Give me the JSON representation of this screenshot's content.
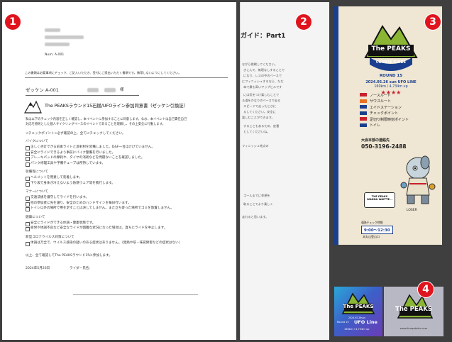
{
  "badges": [
    "1",
    "2",
    "3",
    "4"
  ],
  "doc1": {
    "num": "Num: A-001",
    "note": "この書類は必要事項にチェック、ご記入いただき、受付にご提出いただく書類です。携帯しないようにしてください。",
    "zekken": "ゼッケン A-001",
    "sama": "様",
    "consent_title": "The PEAKSラウンド15石鎚/UFOライン参加同意書（ゼッケン引換証）",
    "intro1": "私は以下のチェック内容を正しく確認し、本イベントに参加することに同意します。なお、本イベントは自己責任自己",
    "intro2": "対応を原則とした個人サイクリングベースのイベントであることを理解し、その上安全に行動します。",
    "checkpoint_heading": "<チェックポイント>必ず確認の上、全てにチェックしてください。",
    "sections": [
      {
        "title": "バイクについて",
        "items": [
          "正しく点灯できる前後ライトと反射材を装備しました。D&F一台ほけけていません。",
          "安全にライドできるよう事前にバイク整備を行いました。",
          "ブレーキパッドの摩耗や、タイヤの消耗などを問題ないことを確認しました。",
          "パンク修理工具や予備チューブは所持しています。"
        ]
      },
      {
        "title": "装備等について",
        "items": [
          "ヘルメットを用意して装着します。",
          "下り坂で身体が冷えないよう防寒ウェア等を携行します。"
        ]
      },
      {
        "title": "マナーについて",
        "items": [
          "交通法規を遵守してライドを行います。",
          "他の参加者に先を譲り、安全のためのハンドサインを毎日行います。",
          "トイレ以外の場所で用を足すことは決してしません。また立ち寄った場所でゴミを放置しません。"
        ]
      },
      {
        "title": "健康について",
        "items": [
          "安全にライドができる体調・健康状態です。",
          "疲労や体調不良など安全なライドが困難な状況になった場合は、直ちにライドを中止します。"
        ]
      },
      {
        "title": "新型コロナウイルス対策について",
        "items": [
          "体調は万全で、ウイルス感染の疑いのある症状はありません。（発熱や咳・味覚障害などの症状はない）"
        ]
      }
    ],
    "confirm": "以上、全て確認してThe PEAKSラウンド15に参加します。",
    "date": "2024年5月26日",
    "rider": "ライダー氏名："
  },
  "doc2": {
    "title": "ガイド：Part1",
    "lines": [
      "ながら挑戦してください。",
      "きこんで、無理なしすることで",
      "になり、レスの中のペースで",
      "にフィニッシュするなら、ただ",
      "本で最も高いアップヒルです",
      "には気をつけ楽しむことで",
      "る道をかなりのペースで走る",
      "スピードで走ったときに",
      "るしてください。安全に",
      "楽しむことができます。",
      "することもあるため、定番",
      "としてくださいね。",
      "フィニッシュ地点の",
      "ゴールまでに休憩を",
      "取ることでより楽しく",
      "走れると思います。"
    ]
  },
  "guide": {
    "logo": "The PEAKS",
    "subtitle": "COURSE GUIDE",
    "round": "ROUND 15",
    "event": "2024.05.26 sun  UFO LINE",
    "stats": "160km / 4,734m up",
    "stars": "★★★★",
    "legend": [
      {
        "label": "ノースルート",
        "color": "#c8202c"
      },
      {
        "label": "サウスルート",
        "color": "#e87020"
      },
      {
        "label": "エイドステーション",
        "color": "#1b3f8f"
      },
      {
        "label": "チェックポイント",
        "color": "#1b3f8f"
      },
      {
        "label": "足切り制限時刻ポイント",
        "color": "#c8202c"
      },
      {
        "label": "トイレ",
        "color": "#1b3f8f"
      }
    ],
    "contact_label": "大会本部の連絡先",
    "phone": "050-3196-2488",
    "mascot_caption": "THE PEAKS WANNA WAITTE...",
    "loser": "LOSER",
    "time_label": "通過チェック時間",
    "time": "9:00〜12:30",
    "location": "本丸山登山口"
  },
  "stickers": {
    "logo": "The PEAKS",
    "sub": "UFO Line",
    "date": "2024.05.26sun",
    "round": "Round 15",
    "stats": "160km / 4,734m up",
    "url": "www.funqotaku.com"
  },
  "colors": {
    "badge": "#e0141e",
    "guide_blue": "#1b3f8f",
    "sticker_green": "#8ab634",
    "sticker_purple": "#4a4ab0"
  }
}
